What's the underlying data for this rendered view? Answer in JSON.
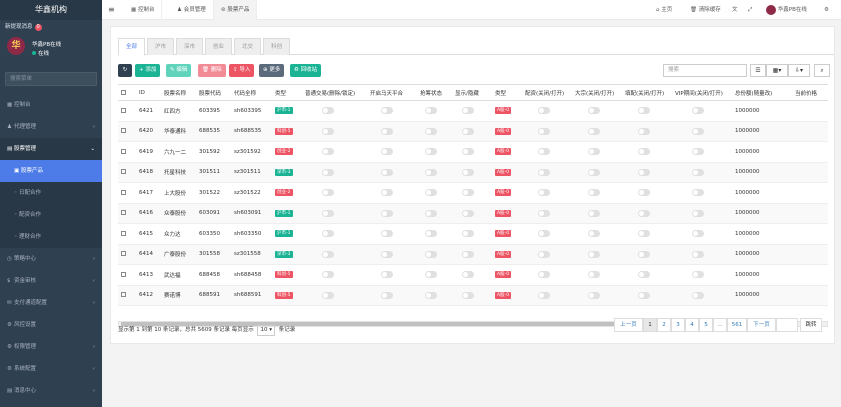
{
  "brand": "华鑫机构",
  "sidebar": {
    "new_msg": "新提现消息",
    "new_msg_count": "0",
    "user_name": "华鑫PB在线",
    "user_status": "在线",
    "search_placeholder": "搜索菜单",
    "items": [
      {
        "icon": "▦",
        "label": "控制台",
        "arrow": ""
      },
      {
        "icon": "♟",
        "label": "代理管理",
        "arrow": "‹"
      },
      {
        "icon": "▤",
        "label": "股票管理",
        "arrow": "⌄"
      }
    ],
    "subs": [
      "股票产品",
      "日配合作",
      "配资合作",
      "理财合作"
    ],
    "items2": [
      {
        "icon": "◷",
        "label": "策略中心",
        "arrow": "‹"
      },
      {
        "icon": "$",
        "label": "资金审核",
        "arrow": "‹"
      },
      {
        "icon": "✉",
        "label": "支付通道配置",
        "arrow": "‹"
      },
      {
        "icon": "⚙",
        "label": "风控设置",
        "arrow": ""
      },
      {
        "icon": "⚙",
        "label": "权限管理",
        "arrow": "‹"
      },
      {
        "icon": "⚙",
        "label": "系统配置",
        "arrow": "‹"
      },
      {
        "icon": "▤",
        "label": "消息中心",
        "arrow": "‹"
      }
    ]
  },
  "topbar": {
    "menu_icon": "≡",
    "tabs": [
      "控制台",
      "会员管理",
      "股票产品"
    ],
    "home": "主页",
    "clear_cache": "清除缓存",
    "user": "华鑫PB在线"
  },
  "content_tabs": [
    "全部",
    "沪市",
    "深市",
    "创业",
    "北交",
    "科创"
  ],
  "toolbar": {
    "refresh": "↻",
    "add": "+ 添加",
    "edit": "✎ 编辑",
    "delete": "🗑 删除",
    "import": "⇪ 导入",
    "more": "⊕ 更多",
    "recycle": "♻ 回收站",
    "search_placeholder": "搜索"
  },
  "table": {
    "headers": [
      "",
      "ID",
      "股票名称",
      "股票代码",
      "代码全称",
      "类型",
      "普通交易(删除/锁定)",
      "开启马天平合",
      "抢筹状态",
      "显示/隐藏",
      "类型",
      "配资(关闭/打开)",
      "大宗(关闭/打开)",
      "填配(关闭/打开)",
      "VIP期间(关闭/打开)",
      "总份额(随量改)",
      "当前价格"
    ],
    "rows": [
      {
        "id": "6421",
        "name": "红四方",
        "code": "603395",
        "full": "sh603395",
        "tag": "沪市-1",
        "tagcolor": "#1ab394",
        "type2": "A股-0",
        "total": "1000000"
      },
      {
        "id": "6420",
        "name": "华泰通科",
        "code": "688535",
        "full": "sh688535",
        "tag": "科创-5",
        "tagcolor": "#ed5565",
        "type2": "A股-0",
        "total": "1000000"
      },
      {
        "id": "6419",
        "name": "六九一二",
        "code": "301592",
        "full": "sz301592",
        "tag": "创业-2",
        "tagcolor": "#ed5565",
        "type2": "A股-0",
        "total": "1000000"
      },
      {
        "id": "6418",
        "name": "托星科技",
        "code": "301511",
        "full": "sz301511",
        "tag": "深市-3",
        "tagcolor": "#1ab394",
        "type2": "A股-0",
        "total": "1000000"
      },
      {
        "id": "6417",
        "name": "上大股份",
        "code": "301522",
        "full": "sz301522",
        "tag": "创业-2",
        "tagcolor": "#ed5565",
        "type2": "A股-0",
        "total": "1000000"
      },
      {
        "id": "6416",
        "name": "众泰股份",
        "code": "603091",
        "full": "sh603091",
        "tag": "沪市-1",
        "tagcolor": "#1ab394",
        "type2": "A股-0",
        "total": "1000000"
      },
      {
        "id": "6415",
        "name": "众力达",
        "code": "603350",
        "full": "sh603350",
        "tag": "沪市-1",
        "tagcolor": "#1ab394",
        "type2": "A股-0",
        "total": "1000000"
      },
      {
        "id": "6414",
        "name": "广泰股份",
        "code": "301558",
        "full": "sz301558",
        "tag": "深市-3",
        "tagcolor": "#1ab394",
        "type2": "A股-0",
        "total": "1000000"
      },
      {
        "id": "6413",
        "name": "武达福",
        "code": "688458",
        "full": "sh688458",
        "tag": "科创-5",
        "tagcolor": "#ed5565",
        "type2": "A股-0",
        "total": "1000000"
      },
      {
        "id": "6412",
        "name": "赛诺博",
        "code": "688591",
        "full": "sh688591",
        "tag": "科创-5",
        "tagcolor": "#ed5565",
        "type2": "A股-0",
        "total": "1000000"
      }
    ]
  },
  "pagination": {
    "info_prefix": "显示第 1 到第 10 条记录，总共 5609 条记录 每页显示",
    "page_size": "10",
    "info_suffix": "条记录",
    "prev": "上一页",
    "pages": [
      "1",
      "2",
      "3",
      "4",
      "5",
      "...",
      "561"
    ],
    "next": "下一页",
    "jump": "跳转"
  },
  "colors": {
    "sidebar_bg": "#2f4050",
    "active_blue": "#4d7ce8",
    "green": "#1ab394",
    "red": "#ed5565"
  }
}
